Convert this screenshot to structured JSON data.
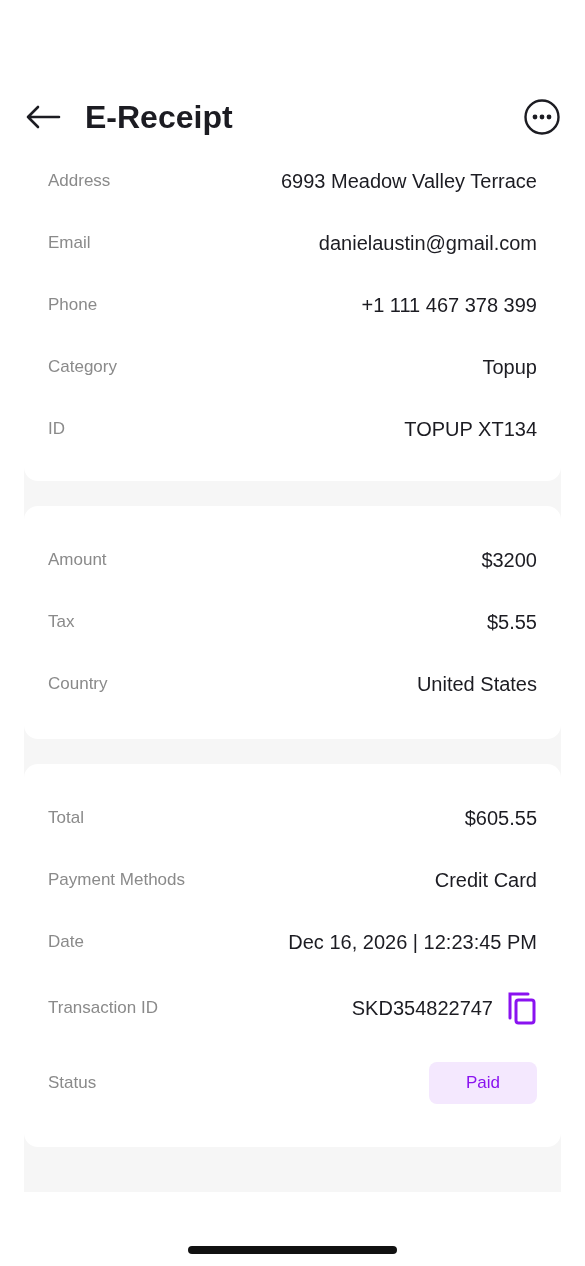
{
  "header": {
    "title": "E-Receipt"
  },
  "cards": [
    {
      "rows": [
        {
          "kind": "text",
          "label": "Address",
          "value": "6993 Meadow Valley Terrace"
        },
        {
          "kind": "text",
          "label": "Email",
          "value": "danielaustin@gmail.com"
        },
        {
          "kind": "text",
          "label": "Phone",
          "value": "+1 111 467 378 399"
        },
        {
          "kind": "text",
          "label": "Category",
          "value": "Topup"
        },
        {
          "kind": "text",
          "label": "ID",
          "value": "TOPUP XT134"
        }
      ]
    },
    {
      "rows": [
        {
          "kind": "text",
          "label": "Amount",
          "value": "$3200"
        },
        {
          "kind": "text",
          "label": "Tax",
          "value": "$5.55"
        },
        {
          "kind": "text",
          "label": "Country",
          "value": "United States"
        }
      ]
    },
    {
      "rows": [
        {
          "kind": "text",
          "label": "Total",
          "value": "$605.55"
        },
        {
          "kind": "text",
          "label": "Payment Methods",
          "value": "Credit Card"
        },
        {
          "kind": "text",
          "label": "Date",
          "value": "Dec 16, 2026 | 12:23:45 PM"
        },
        {
          "kind": "copy",
          "label": "Transaction ID",
          "value": "SKD354822747"
        },
        {
          "kind": "badge",
          "label": "Status",
          "value": "Paid"
        }
      ]
    }
  ]
}
